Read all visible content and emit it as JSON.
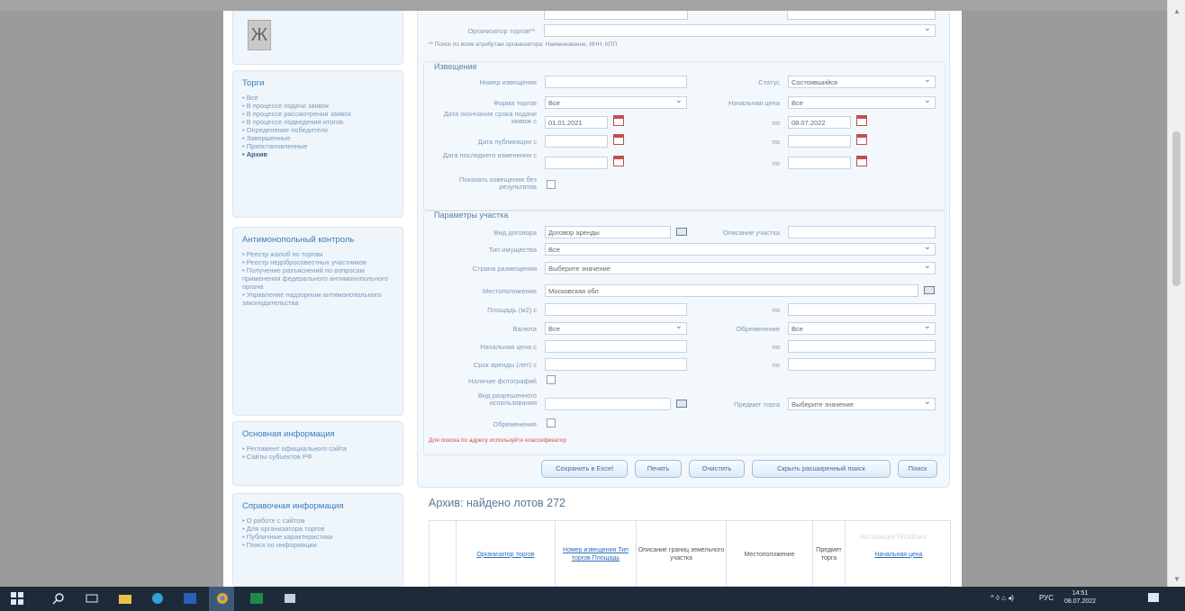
{
  "sidebar": {
    "logo_glyph": "Ж",
    "box1": {
      "title": "Торги",
      "items": [
        "Все",
        "В процессе подачи заявок",
        "В процессе рассмотрения заявок",
        "В процессе подведения итогов",
        "Определение победителя",
        "Завершенные",
        "Приостановленные",
        "Архив"
      ]
    },
    "box2": {
      "title": "Антимонопольный контроль",
      "items": [
        "Реестр жалоб по торгам",
        "Реестр недобросовестных участников",
        "Получение разъяснений по вопросам применения федерального антимонопольного органа",
        "Управление надзорным антимонопольного законодательства"
      ]
    },
    "box3": {
      "title": "Основная информация",
      "items": [
        "Регламент официального сайта",
        "Сайты субъектов РФ"
      ]
    },
    "box4": {
      "title": "Справочная информация",
      "items": [
        "О работе с сайтом",
        "Для организатора торгов",
        "Публичные характеристики",
        "Поиск по информации"
      ]
    }
  },
  "filters": {
    "top": {
      "org_label": "Организатор торгов**",
      "hint": "** Поиск по всем атрибутам организатора: Наименование, ИНН, КПП"
    },
    "notice": {
      "title": "Извещение",
      "number_label": "Номер извещения",
      "status_label": "Статус",
      "status_value": "Состоявшийся",
      "form_label": "Форма торгов",
      "form_value": "Все",
      "method_label": "Начальная цена",
      "method_value": "Все",
      "date_pub_label": "Дата окончания срока подачи заявок с",
      "date_pub_from": "01.01.2021",
      "to_label": "по",
      "date_pub_to": "08.07.2022",
      "date_bid_label": "Дата публикации с",
      "date_change_label": "Дата последнего изменения с",
      "show_label": "Показать извещения без результатов"
    },
    "lot": {
      "title": "Параметры участка",
      "contract_label": "Вид договора",
      "contract_value": "Договор аренды",
      "desc_label": "Описание участка",
      "property_label": "Тип имущества",
      "property_value": "Все",
      "country_label": "Страна размещения",
      "country_value": "Выберите значение",
      "location_label": "Местоположение",
      "location_value": "Московская обл",
      "area_label": "Площадь (м2) с",
      "currency_label": "Валюта",
      "currency_value": "Все",
      "encumbrance_label": "Обременение",
      "encumbrance_value": "Все",
      "price_label": "Начальная цена с",
      "term_label": "Срок аренды (лет) с",
      "photo_label": "Наличие фотографий",
      "permitted_label": "Вид разрешенного использования",
      "subject_label": "Предмет торга",
      "subject_value": "Выберите значение",
      "burden_label": "Обременение",
      "warning": "Для поиска по адресу используйте классификатор"
    },
    "buttons": [
      "Сохранить в Excel",
      "Печать",
      "Очистить",
      "Скрыть расширенный поиск",
      "Поиск"
    ]
  },
  "results": {
    "title": "Архив: найдено лотов 272",
    "columns": [
      "Организатор торгов",
      "Номер извещения Тип торгов Площадь",
      "Описание границ земельного участка",
      "Местоположение",
      "Предмет торга",
      "Начальная цена"
    ],
    "watermark": "Активация Windows"
  },
  "taskbar": {
    "time": "14:51",
    "date": "08.07.2022",
    "lang": "РУС"
  }
}
